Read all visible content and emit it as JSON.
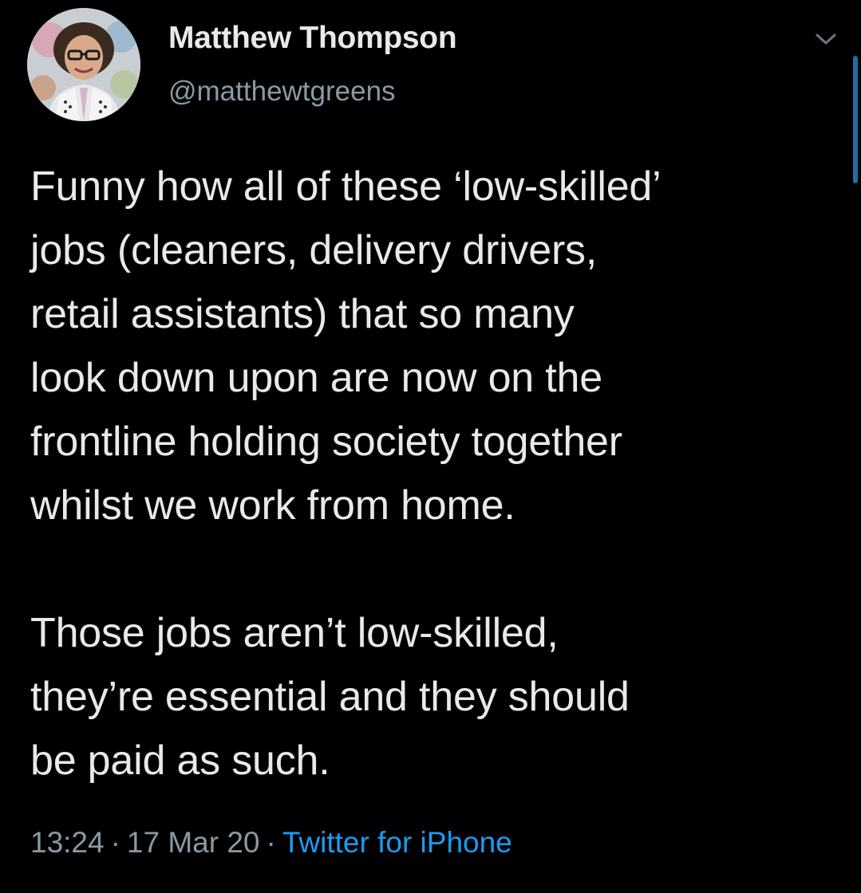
{
  "tweet": {
    "author": {
      "display_name": "Matthew Thompson",
      "handle": "@matthewtgreens",
      "avatar_icon": "profile-photo"
    },
    "menu_icon": "chevron-down-icon",
    "body": "Funny how all of these ‘low-skilled’\njobs (cleaners, delivery drivers,\nretail assistants) that so many\nlook down upon are now on the\nfrontline holding society together\nwhilst we work from home.\n\nThose jobs aren’t low-skilled,\nthey’re essential and they should\nbe paid as such.",
    "time": "13:24",
    "separator": "·",
    "date": "17 Mar 20",
    "source": "Twitter for iPhone"
  },
  "colors": {
    "background": "#000000",
    "text": "#e7e9ea",
    "secondary_text": "#8b98a5",
    "link": "#1d9bf0"
  }
}
